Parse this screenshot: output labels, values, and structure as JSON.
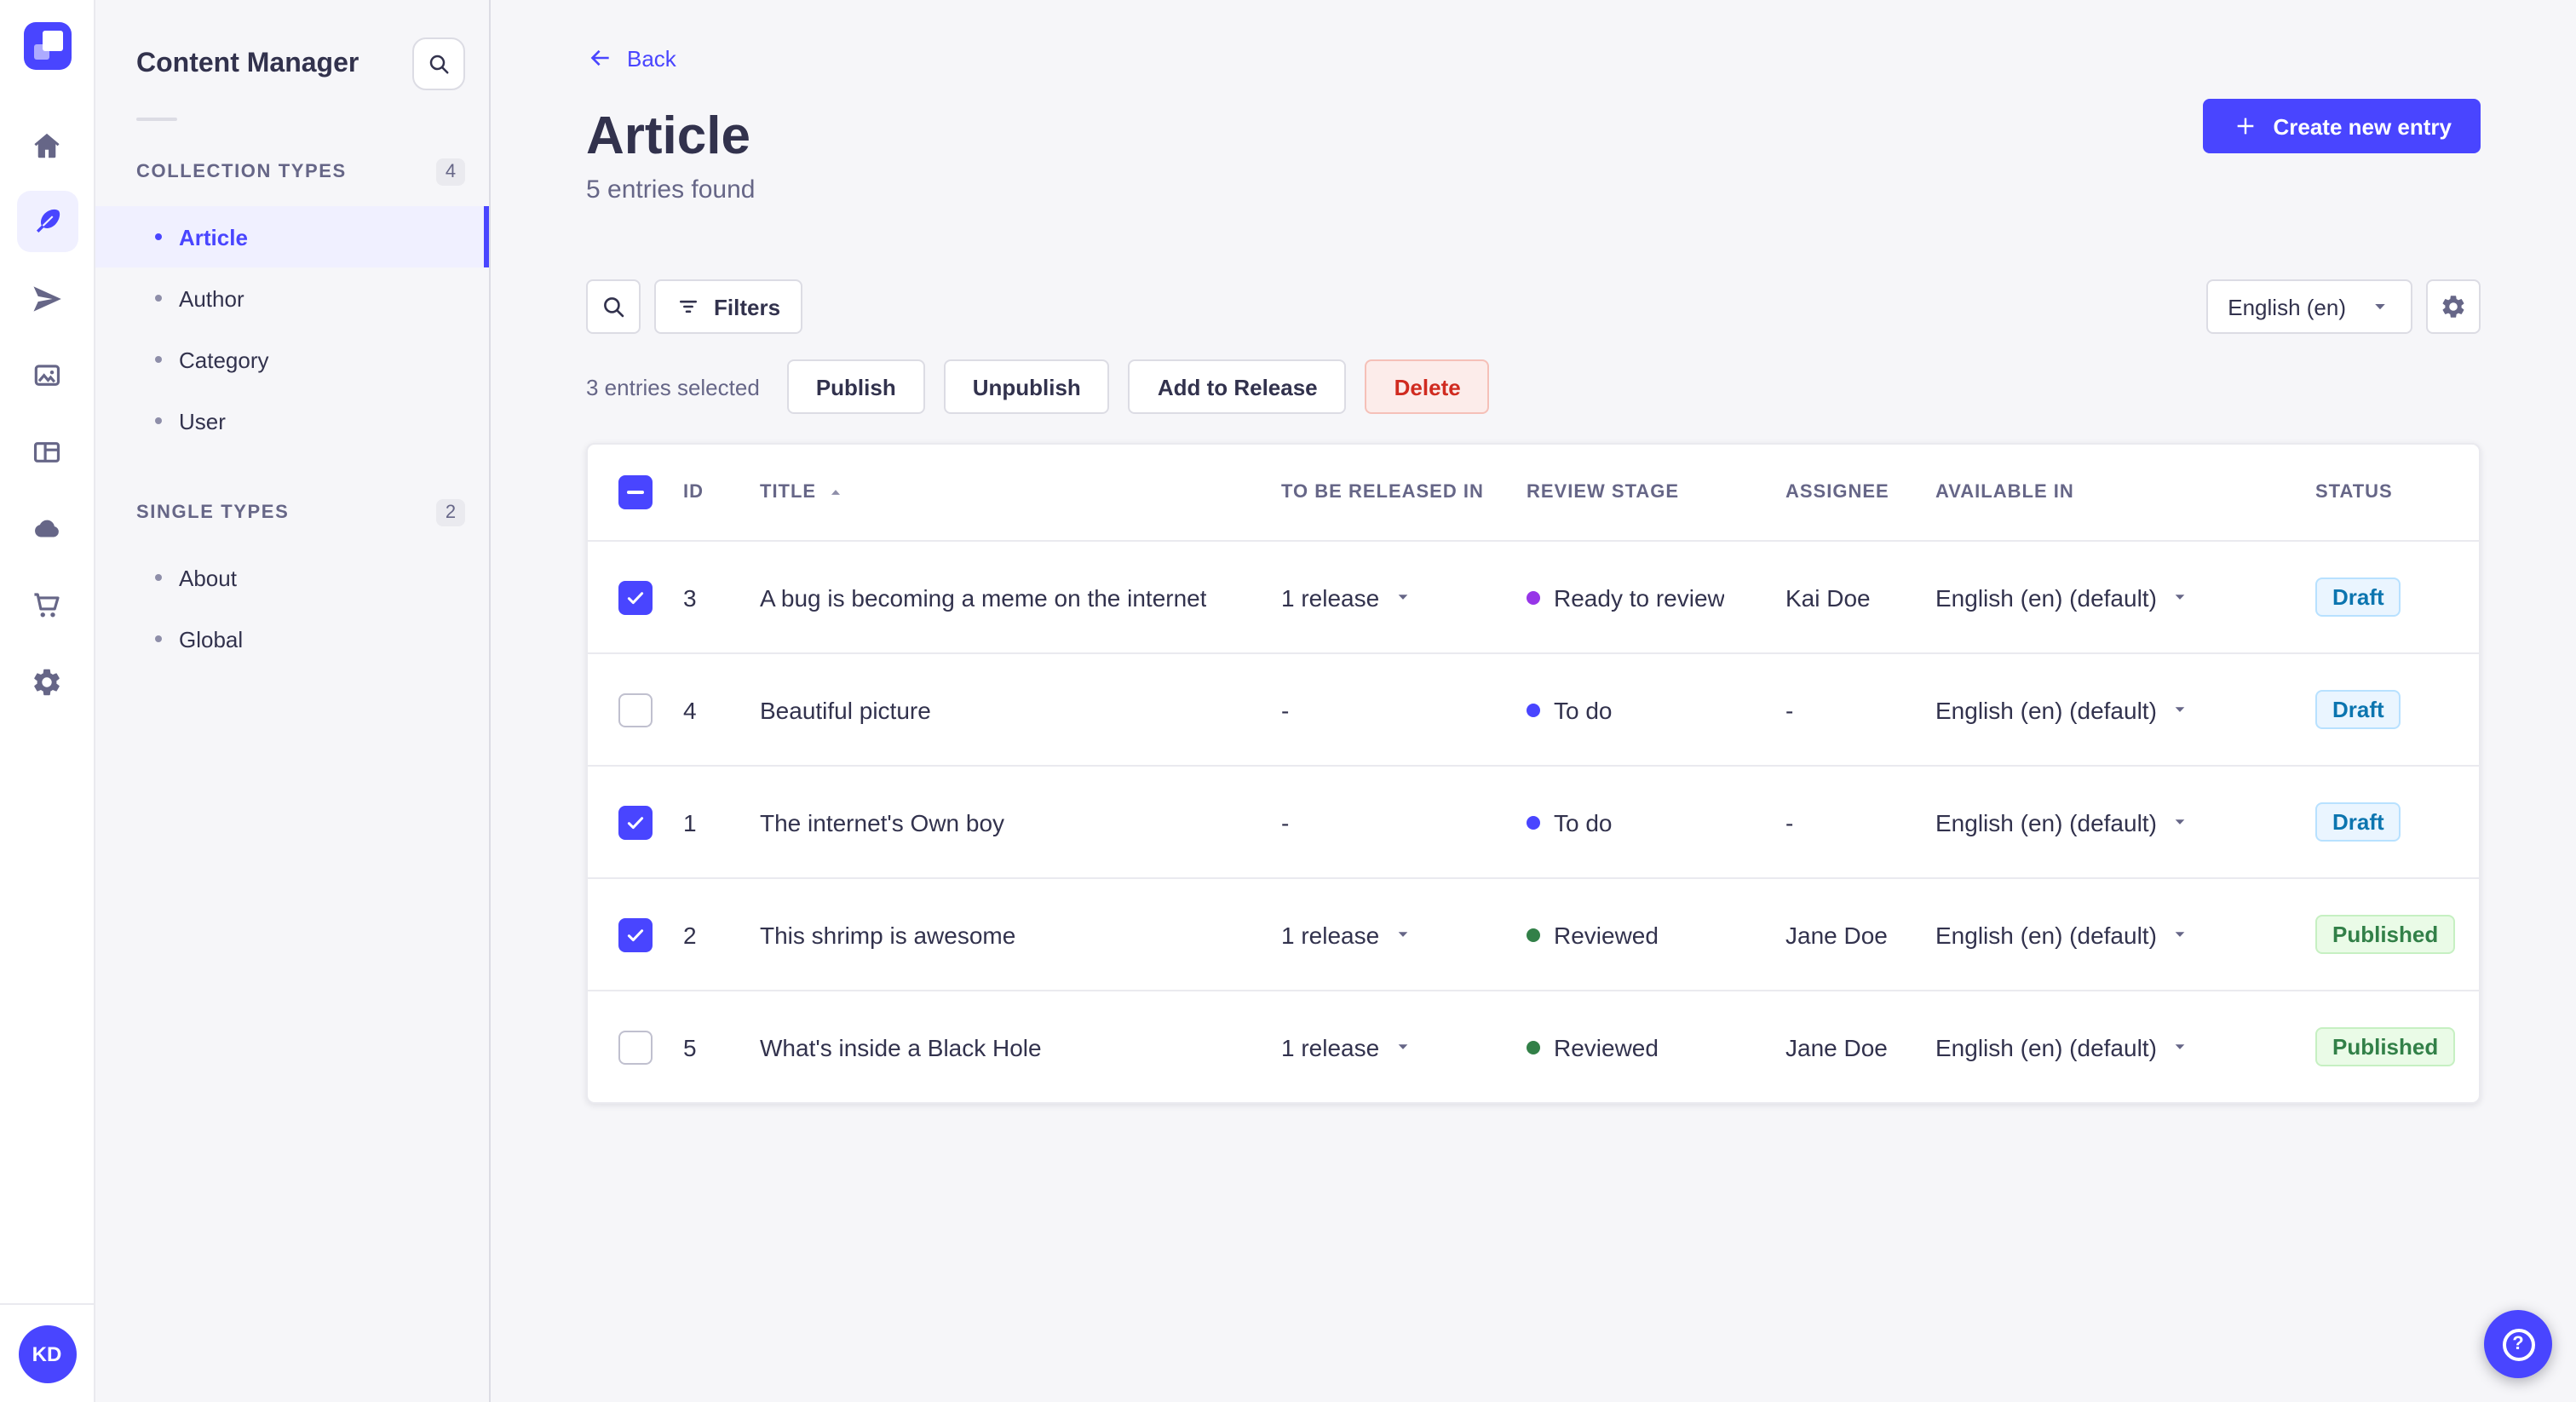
{
  "nav_rail": {
    "items": [
      {
        "icon": "home",
        "active": false
      },
      {
        "icon": "feather",
        "active": true
      },
      {
        "icon": "send",
        "active": false
      },
      {
        "icon": "media",
        "active": false
      },
      {
        "icon": "layout",
        "active": false
      },
      {
        "icon": "cloud",
        "active": false
      },
      {
        "icon": "cart",
        "active": false
      },
      {
        "icon": "gear",
        "active": false
      }
    ],
    "avatar_initials": "KD"
  },
  "subnav": {
    "title": "Content Manager",
    "sections": [
      {
        "label": "COLLECTION TYPES",
        "count": "4",
        "items": [
          {
            "label": "Article",
            "active": true
          },
          {
            "label": "Author",
            "active": false
          },
          {
            "label": "Category",
            "active": false
          },
          {
            "label": "User",
            "active": false
          }
        ]
      },
      {
        "label": "SINGLE TYPES",
        "count": "2",
        "items": [
          {
            "label": "About",
            "active": false
          },
          {
            "label": "Global",
            "active": false
          }
        ]
      }
    ]
  },
  "header": {
    "back_label": "Back",
    "title": "Article",
    "subtitle": "5 entries found",
    "create_button": "Create new entry"
  },
  "toolbar": {
    "filters_label": "Filters",
    "locale": "English (en)"
  },
  "selection": {
    "label": "3 entries selected",
    "actions": [
      "Publish",
      "Unpublish",
      "Add to Release"
    ],
    "delete_label": "Delete"
  },
  "table": {
    "columns": [
      "ID",
      "TITLE",
      "TO BE RELEASED IN",
      "REVIEW STAGE",
      "ASSIGNEE",
      "AVAILABLE IN",
      "STATUS"
    ],
    "sort": {
      "column": "TITLE",
      "direction": "asc"
    },
    "header_checkbox": "indeterminate",
    "rows": [
      {
        "selected": true,
        "id": "3",
        "title": "A bug is becoming a meme on the internet",
        "release": "1 release",
        "review_stage": "Ready to review",
        "assignee": "Kai Doe",
        "available_in": "English (en) (default)",
        "status": "Draft"
      },
      {
        "selected": false,
        "id": "4",
        "title": "Beautiful picture",
        "release": "-",
        "review_stage": "To do",
        "assignee": "-",
        "available_in": "English (en) (default)",
        "status": "Draft"
      },
      {
        "selected": true,
        "id": "1",
        "title": "The internet's Own boy",
        "release": "-",
        "review_stage": "To do",
        "assignee": "-",
        "available_in": "English (en) (default)",
        "status": "Draft"
      },
      {
        "selected": true,
        "id": "2",
        "title": "This shrimp is awesome",
        "release": "1 release",
        "review_stage": "Reviewed",
        "assignee": "Jane Doe",
        "available_in": "English (en) (default)",
        "status": "Published"
      },
      {
        "selected": false,
        "id": "5",
        "title": "What's inside a Black Hole",
        "release": "1 release",
        "review_stage": "Reviewed",
        "assignee": "Jane Doe",
        "available_in": "English (en) (default)",
        "status": "Published"
      }
    ]
  },
  "fab": {
    "glyph": "?"
  },
  "colors": {
    "primary": "#4945ff",
    "danger_text": "#d02b20",
    "draft_text": "#0c75af",
    "published_text": "#328048",
    "stage_colors": {
      "Ready to review": "#9736e8",
      "To do": "#4945ff",
      "Reviewed": "#328048"
    }
  }
}
